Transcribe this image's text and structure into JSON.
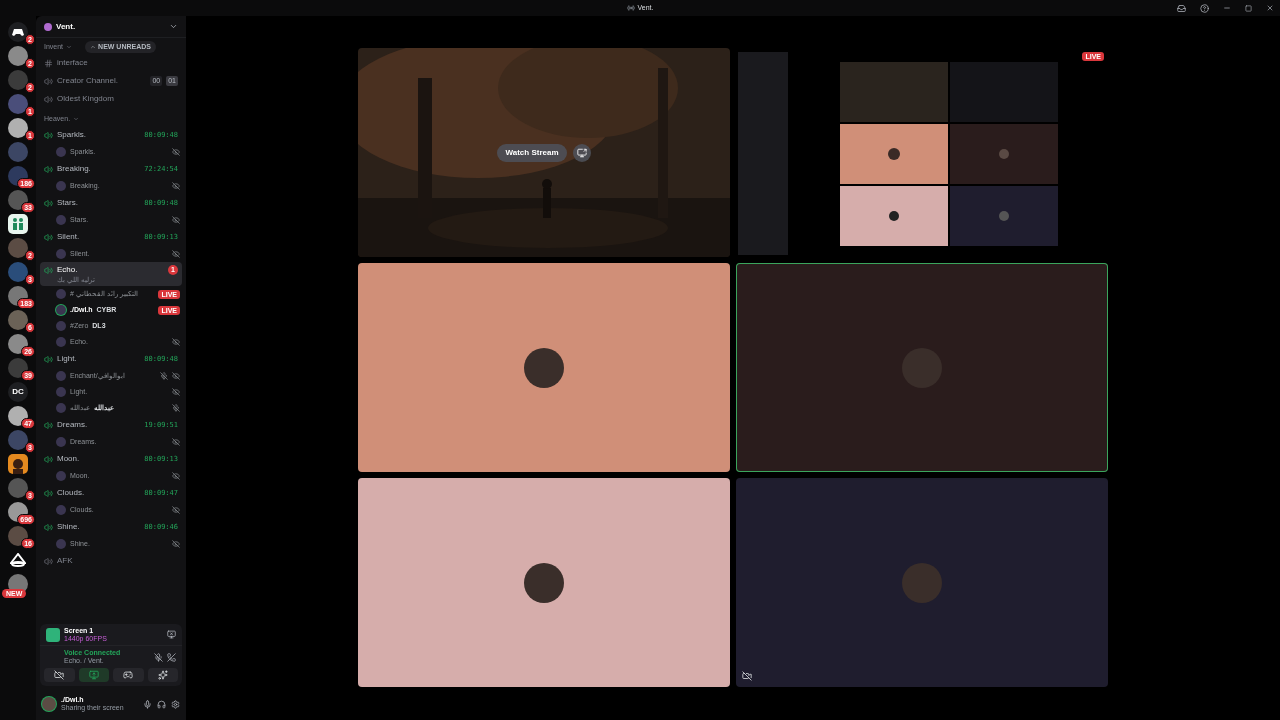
{
  "titlebar": {
    "title": "Vent."
  },
  "rail": [
    {
      "kind": "logo",
      "badge": "2"
    },
    {
      "kind": "avatar",
      "badge": "2"
    },
    {
      "kind": "avatar",
      "badge": "2"
    },
    {
      "kind": "avatar",
      "badge": "1"
    },
    {
      "kind": "avatar",
      "badge": "1"
    },
    {
      "kind": "avatar"
    },
    {
      "kind": "avatar",
      "badge": "186"
    },
    {
      "kind": "avatar",
      "badge": "33"
    },
    {
      "kind": "app"
    },
    {
      "kind": "avatar",
      "badge": "2"
    },
    {
      "kind": "avatar",
      "badge": "3"
    },
    {
      "kind": "avatar",
      "badge": "183"
    },
    {
      "kind": "avatar",
      "badge": "6"
    },
    {
      "kind": "avatar",
      "badge": "26"
    },
    {
      "kind": "avatar",
      "badge": "39"
    },
    {
      "kind": "text",
      "label": "DC"
    },
    {
      "kind": "avatar",
      "badge": "47"
    },
    {
      "kind": "avatar",
      "badge": "3"
    },
    {
      "kind": "orange"
    },
    {
      "kind": "avatar",
      "badge": "3"
    },
    {
      "kind": "avatar",
      "badge": "696"
    },
    {
      "kind": "avatar",
      "badge": "16"
    },
    {
      "kind": "mark"
    },
    {
      "kind": "avatar",
      "pill": "NEW"
    }
  ],
  "server": {
    "name": "Vent.",
    "new_unreads": "NEW UNREADS"
  },
  "categories": [
    {
      "name": "Invent",
      "channels": [
        {
          "kind": "text",
          "name": "interface",
          "active": false,
          "selected": false
        },
        {
          "kind": "voice",
          "name": "Creator Channel.",
          "active": false,
          "selected": false,
          "counters": [
            "00",
            "01"
          ]
        },
        {
          "kind": "voice",
          "name": "Oldest Kingdom",
          "active": false,
          "selected": false
        }
      ]
    },
    {
      "name": "Heaven.",
      "channels": [
        {
          "kind": "voice",
          "name": "Sparkls.",
          "active": true,
          "selected": false,
          "timer": "80:09:48",
          "members": [
            {
              "name": "Sparkls.",
              "mic_off": false,
              "hidden": true
            }
          ]
        },
        {
          "kind": "voice",
          "name": "Breaking.",
          "active": true,
          "selected": false,
          "timer": "72:24:54",
          "members": [
            {
              "name": "Breaking.",
              "mic_off": false,
              "hidden": true
            }
          ]
        },
        {
          "kind": "voice",
          "name": "Stars.",
          "active": true,
          "selected": false,
          "timer": "80:09:48",
          "members": [
            {
              "name": "Stars.",
              "mic_off": false,
              "hidden": true
            }
          ]
        },
        {
          "kind": "voice",
          "name": "Silent.",
          "active": true,
          "selected": false,
          "timer": "80:09:13",
          "members": [
            {
              "name": "Silent.",
              "mic_off": false,
              "hidden": true
            }
          ]
        },
        {
          "kind": "voice",
          "name": "Echo.",
          "active": true,
          "selected": true,
          "subtitle": "ترليه اللي بك",
          "unread": "1",
          "members": [
            {
              "name": "# التكبير رائد القحطاني",
              "live": "LIVE",
              "mic_off": false,
              "hidden": false
            },
            {
              "name": "./Dwl.h",
              "tag": "CYBR",
              "live": "LIVE",
              "mic_off": false,
              "hidden": false,
              "me": true
            },
            {
              "name": "#Zero",
              "tag": "DL3",
              "mic_off": false,
              "hidden": false
            },
            {
              "name": "Echo.",
              "mic_off": false,
              "hidden": true
            }
          ]
        },
        {
          "kind": "voice",
          "name": "Light.",
          "active": true,
          "selected": false,
          "timer": "80:09:48",
          "members": [
            {
              "name": "Enchant/ابوالوافي",
              "mic_off": true,
              "hidden": true
            },
            {
              "name": "Light.",
              "mic_off": false,
              "hidden": true
            },
            {
              "name": "عبدالله",
              "tag": "عبدالله",
              "mic_off": true,
              "hidden": false
            }
          ]
        },
        {
          "kind": "voice",
          "name": "Dreams.",
          "active": true,
          "selected": false,
          "timer": "19:09:51",
          "members": [
            {
              "name": "Dreams.",
              "mic_off": false,
              "hidden": true
            }
          ]
        },
        {
          "kind": "voice",
          "name": "Moon.",
          "active": true,
          "selected": false,
          "timer": "80:09:13",
          "members": [
            {
              "name": "Moon.",
              "mic_off": false,
              "hidden": true
            }
          ]
        },
        {
          "kind": "voice",
          "name": "Clouds.",
          "active": true,
          "selected": false,
          "timer": "80:09:47",
          "members": [
            {
              "name": "Clouds.",
              "mic_off": false,
              "hidden": true
            }
          ]
        },
        {
          "kind": "voice",
          "name": "Shine.",
          "active": true,
          "selected": false,
          "timer": "80:09:46",
          "members": [
            {
              "name": "Shine.",
              "mic_off": false,
              "hidden": true
            }
          ]
        },
        {
          "kind": "voice",
          "name": "AFK",
          "active": false,
          "selected": false
        }
      ]
    }
  ],
  "stream_panel": {
    "title": "Screen 1",
    "quality": "1440p 60FPS"
  },
  "voice_panel": {
    "status": "Voice Connected",
    "location": "Echo. / Vent."
  },
  "actions": [
    {
      "kind": "camera",
      "selected": false
    },
    {
      "kind": "screen",
      "selected": true
    },
    {
      "kind": "activity",
      "selected": false
    },
    {
      "kind": "soundboard",
      "selected": false
    }
  ],
  "user": {
    "name": "./Dwl.h",
    "status": "Sharing their screen"
  },
  "tiles": [
    {
      "kind": "stream",
      "button": "Watch Stream"
    },
    {
      "kind": "screen",
      "live": "LIVE"
    },
    {
      "kind": "user",
      "color": "#d08f78",
      "speaking": false,
      "video_off": false
    },
    {
      "kind": "user",
      "color": "#2a1c1c",
      "speaking": true,
      "video_off": false
    },
    {
      "kind": "user",
      "color": "#d6adab",
      "speaking": false,
      "video_off": false
    },
    {
      "kind": "user",
      "color": "#1f1d2e",
      "speaking": false,
      "video_off": true
    }
  ]
}
